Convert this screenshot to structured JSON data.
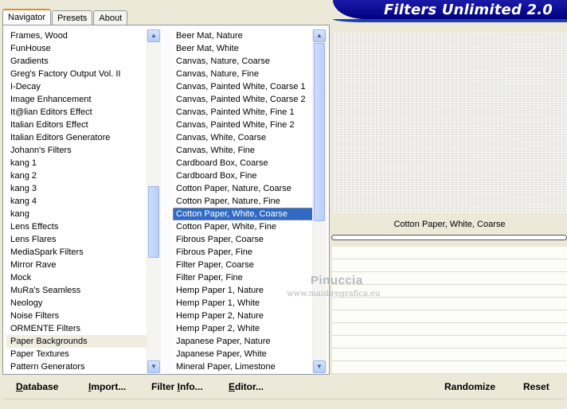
{
  "tabs": [
    "Navigator",
    "Presets",
    "About"
  ],
  "app_title": "Filters Unlimited 2.0",
  "categories": [
    "Frames, Wood",
    "FunHouse",
    "Gradients",
    "Greg's Factory Output Vol. II",
    "I-Decay",
    "Image Enhancement",
    "It@lian Editors Effect",
    "Italian Editors Effect",
    "Italian Editors Generatore",
    "Johann's Filters",
    "kang 1",
    "kang 2",
    "kang 3",
    "kang 4",
    "kang",
    "Lens Effects",
    "Lens Flares",
    "MediaSpark Filters",
    "Mirror Rave",
    "Mock",
    "MuRa's Seamless",
    "Neology",
    "Noise Filters",
    "ORMENTE Filters",
    "Paper Backgrounds",
    "Paper Textures",
    "Pattern Generators"
  ],
  "selected_category": "Paper Backgrounds",
  "filters": [
    "Beer Mat, Nature",
    "Beer Mat, White",
    "Canvas, Nature, Coarse",
    "Canvas, Nature, Fine",
    "Canvas, Painted White, Coarse 1",
    "Canvas, Painted White, Coarse 2",
    "Canvas, Painted White, Fine 1",
    "Canvas, Painted White, Fine 2",
    "Canvas, White, Coarse",
    "Canvas, White, Fine",
    "Cardboard Box, Coarse",
    "Cardboard Box, Fine",
    "Cotton Paper, Nature, Coarse",
    "Cotton Paper, Nature, Fine",
    "Cotton Paper, White, Coarse",
    "Cotton Paper, White, Fine",
    "Fibrous Paper, Coarse",
    "Fibrous Paper, Fine",
    "Filter Paper, Coarse",
    "Filter Paper, Fine",
    "Hemp Paper 1, Nature",
    "Hemp Paper 1, White",
    "Hemp Paper 2, Nature",
    "Hemp Paper 2, White",
    "Japanese Paper, Nature",
    "Japanese Paper, White",
    "Mineral Paper, Limestone"
  ],
  "selected_filter": "Cotton Paper, White, Coarse",
  "current_filter_name": "Cotton Paper, White, Coarse",
  "watermark": {
    "line1": "Pinuccia",
    "line2": "www.maidiregrafica.eu"
  },
  "buttons": {
    "database": {
      "underlined": "D",
      "rest": "atabase"
    },
    "import": {
      "underlined": "I",
      "rest": "mport..."
    },
    "filter_info": {
      "pre": "Filter ",
      "underlined": "I",
      "rest": "nfo..."
    },
    "editor": {
      "underlined": "E",
      "rest": "ditor..."
    },
    "randomize": "Randomize",
    "reset": "Reset"
  },
  "colors": {
    "title_bar": "#000080",
    "selection": "#316ac5",
    "tab_accent": "#e68b2c"
  },
  "icons": {
    "scroll_up": "▲",
    "scroll_down": "▼"
  }
}
